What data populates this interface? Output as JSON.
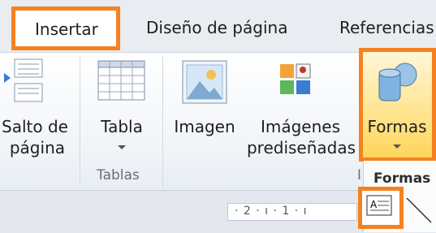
{
  "tabs": {
    "insert": "Insertar",
    "page_layout": "Diseño de página",
    "references": "Referencias"
  },
  "ribbon": {
    "page_break": {
      "line1": "Salto de",
      "line2": "página"
    },
    "table": {
      "label": "Tabla",
      "group": "Tablas"
    },
    "image": {
      "label": "Imagen"
    },
    "clipart": {
      "line1": "Imágenes",
      "line2": "prediseñadas"
    },
    "shapes": {
      "label": "Formas"
    },
    "illustrations_group_fragment": "I"
  },
  "shapes_panel": {
    "title": "Formas"
  },
  "ruler": {
    "text": "· 2 · ı · 1 · ı"
  },
  "colors": {
    "highlight": "#f58220",
    "shapes_fill": "#ffd65c"
  }
}
